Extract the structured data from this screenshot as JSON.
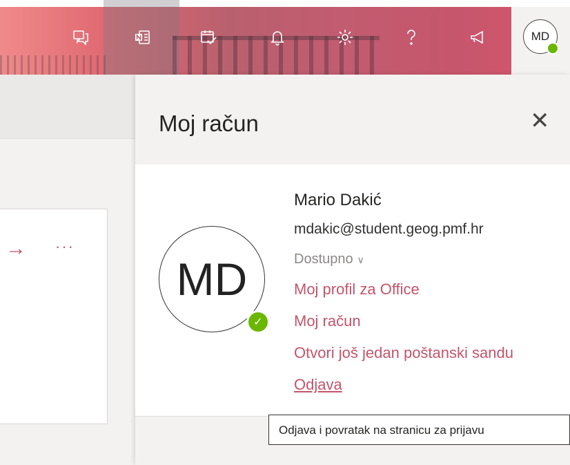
{
  "header": {
    "icons": [
      {
        "name": "chat-icon"
      },
      {
        "name": "onenote-icon"
      },
      {
        "name": "tasks-icon"
      },
      {
        "name": "bell-icon"
      },
      {
        "name": "gear-icon"
      },
      {
        "name": "help-icon"
      },
      {
        "name": "megaphone-icon"
      }
    ],
    "avatar_initials": "MD",
    "status_color": "#6bb700"
  },
  "left": {
    "arrow_glyph": "→",
    "more_glyph": "···"
  },
  "panel": {
    "title": "Moj račun",
    "close_glyph": "✕",
    "user": {
      "initials": "MD",
      "name": "Mario Dakić",
      "email": "mdakic@student.geog.pmf.hr",
      "status": "Dostupno",
      "status_chevron": "∨"
    },
    "links": {
      "office_profile": "Moj profil za Office",
      "my_account": "Moj račun",
      "open_mailbox": "Otvori još jedan poštanski sandu",
      "sign_out": "Odjava"
    },
    "accent_color": "#c4546a"
  },
  "tooltip": {
    "text": "Odjava i povratak na stranicu za prijavu"
  }
}
